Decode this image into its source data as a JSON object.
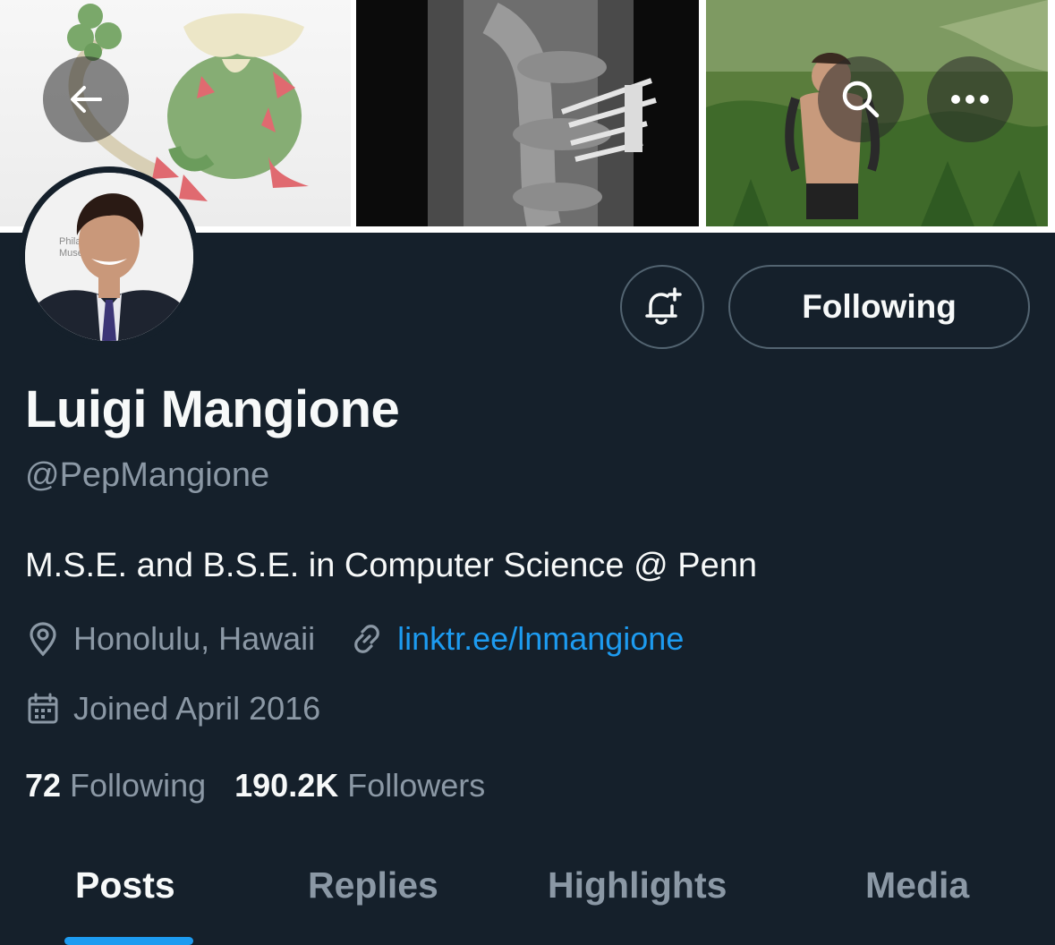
{
  "profile": {
    "name": "Luigi Mangione",
    "handle": "@PepMangione",
    "bio": "M.S.E. and B.S.E. in Computer Science @ Penn",
    "location": "Honolulu, Hawaii",
    "website": "linktr.ee/lnmangione",
    "joined": "Joined April 2016"
  },
  "avatar_backdrop_text": [
    "Philad",
    "Muse"
  ],
  "actions": {
    "following_label": "Following"
  },
  "stats": {
    "following_count": "72",
    "following_label": "Following",
    "followers_count": "190.2K",
    "followers_label": "Followers"
  },
  "tabs": [
    {
      "label": "Posts",
      "active": true
    },
    {
      "label": "Replies",
      "active": false
    },
    {
      "label": "Highlights",
      "active": false
    },
    {
      "label": "Media",
      "active": false
    }
  ],
  "colors": {
    "background": "#15202b",
    "accent": "#1d9bf0",
    "secondary_text": "#8b98a5",
    "border": "#536471"
  },
  "icons": [
    "arrow-left-icon",
    "search-icon",
    "more-horizontal-icon",
    "bell-plus-icon",
    "location-pin-icon",
    "link-icon",
    "calendar-icon"
  ]
}
